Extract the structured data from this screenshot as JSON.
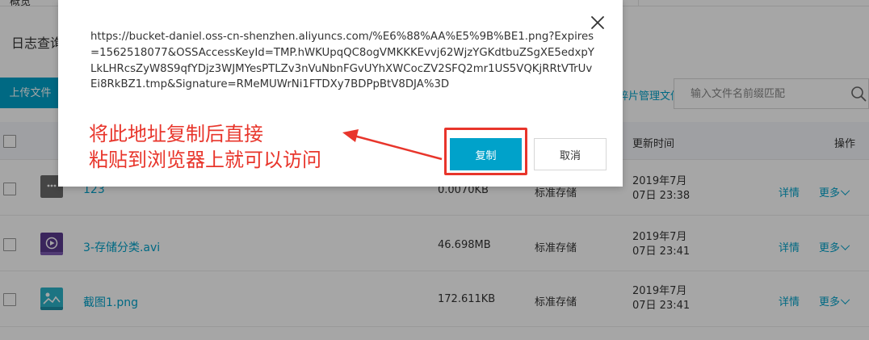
{
  "background": {
    "top_tab_label": "概览",
    "page_heading": "日志查询",
    "upload_button": "上传文件",
    "manage_files_link": "碎片管理文件",
    "search": {
      "placeholder": "输入文件名前缀匹配"
    },
    "table": {
      "headers": {
        "modified": "更新时间",
        "actions": "操作"
      },
      "rows": [
        {
          "name": "123",
          "size": "0.0070KB",
          "storage": "标准存储",
          "time_line1": "2019年7月",
          "time_line2": "07日 23:38",
          "detail": "详情",
          "more": "更多",
          "icon": "folder-file-icon"
        },
        {
          "name": "3-存储分类.avi",
          "size": "46.698MB",
          "storage": "标准存储",
          "time_line1": "2019年7月",
          "time_line2": "07日 23:41",
          "detail": "详情",
          "more": "更多",
          "icon": "video-file-icon"
        },
        {
          "name": "截图1.png",
          "size": "172.611KB",
          "storage": "标准存储",
          "time_line1": "2019年7月",
          "time_line2": "07日 23:41",
          "detail": "详情",
          "more": "更多",
          "icon": "image-file-icon"
        }
      ]
    }
  },
  "modal": {
    "url_text": "https://bucket-daniel.oss-cn-shenzhen.aliyuncs.com/%E6%88%AA%E5%9B%BE1.png?Expires=1562518077&OSSAccessKeyId=TMP.hWKUpqQC8ogVMKKKEvvj62WjzYGKdtbuZSgXE5edxpYLkLHRcsZyW8S9qfYDjz3WJMYesPTLZv3nVuNbnFGvUYhXWCocZV2SFQ2mr1US5VQKjRRtVTrUvEi8RkBZ1.tmp&Signature=RMeMUWrNi1FTDXy7BDPpBtV8DJA%3D",
    "copy_button": "复制",
    "cancel_button": "取消"
  },
  "annotation": {
    "line1": "将此地址复制后直接",
    "line2": "粘贴到浏览器上就可以访问"
  },
  "colors": {
    "accent": "#00a2ca",
    "annotation_red": "#e8352b",
    "video_icon": "#5a3a8e",
    "image_icon": "#2bb3c8"
  }
}
